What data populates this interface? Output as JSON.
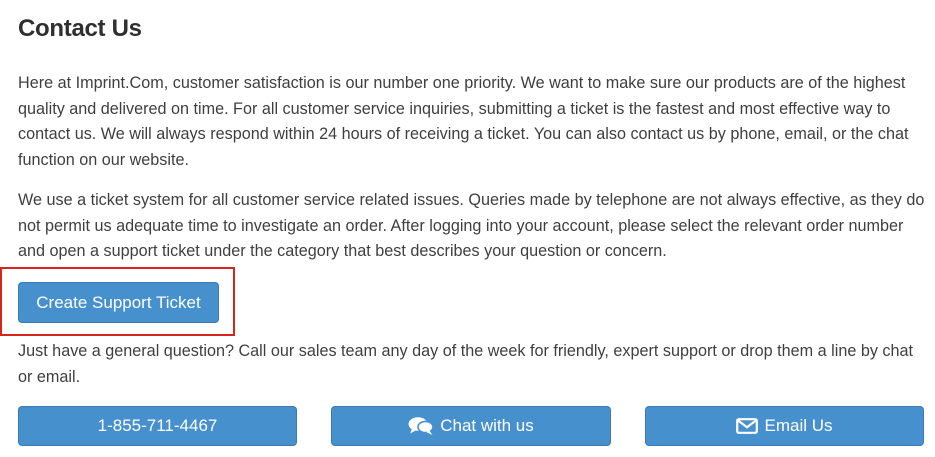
{
  "page": {
    "title": "Contact Us",
    "paragraphs": [
      "Here at Imprint.Com, customer satisfaction is our number one priority. We want to make sure our products are of the highest quality and delivered on time. For all customer service inquiries, submitting a ticket is the fastest and most effective way to contact us. We will always respond within 24 hours of receiving a ticket. You can also contact us by phone, email, or the chat function on our website.",
      "We use a ticket system for all customer service related issues. Queries made by telephone are not always effective, as they do not permit us adequate time to investigate an order. After logging into your account, please select the relevant order number and open a support ticket under the category that best describes your question or concern.",
      "Just have a general question? Call our sales team any day of the week for friendly, expert support or drop them a line by chat or email."
    ]
  },
  "buttons": {
    "support_ticket": "Create Support Ticket",
    "phone": "1-855-711-4467",
    "chat": "Chat with us",
    "email": "Email Us"
  },
  "icons": {
    "chat": "comments-icon",
    "email": "envelope-icon"
  },
  "colors": {
    "button_bg": "#4690cd",
    "button_text": "#ffffff",
    "highlight": "#d9241b",
    "text": "#3f3f3f"
  }
}
